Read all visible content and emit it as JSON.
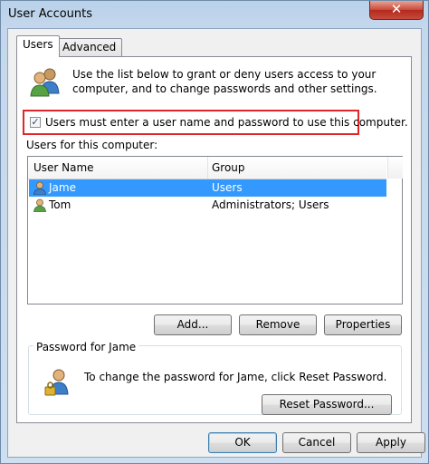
{
  "window": {
    "title": "User Accounts",
    "close_glyph": "✕"
  },
  "tabs": [
    {
      "label": "Users"
    },
    {
      "label": "Advanced"
    }
  ],
  "intro_text": "Use the list below to grant or deny users access to your computer, and to change passwords and other settings.",
  "require_login": {
    "label": "Users must enter a user name and password to use this computer.",
    "checked": true,
    "glyph": "✓"
  },
  "users_label": "Users for this computer:",
  "table": {
    "columns": [
      "User Name",
      "Group"
    ],
    "rows": [
      {
        "name": "Jame",
        "group": "Users",
        "selected": true
      },
      {
        "name": "Tom",
        "group": "Administrators; Users",
        "selected": false
      }
    ]
  },
  "buttons": {
    "add": "Add...",
    "remove": "Remove",
    "properties": "Properties"
  },
  "password_group": {
    "title": "Password for Jame",
    "text": "To change the password for Jame, click Reset Password.",
    "reset_button": "Reset Password..."
  },
  "dialog_buttons": {
    "ok": "OK",
    "cancel": "Cancel",
    "apply": "Apply"
  },
  "icons": {
    "users": "users-icon",
    "user_row": "user-icon",
    "password_user": "user-password-icon"
  }
}
